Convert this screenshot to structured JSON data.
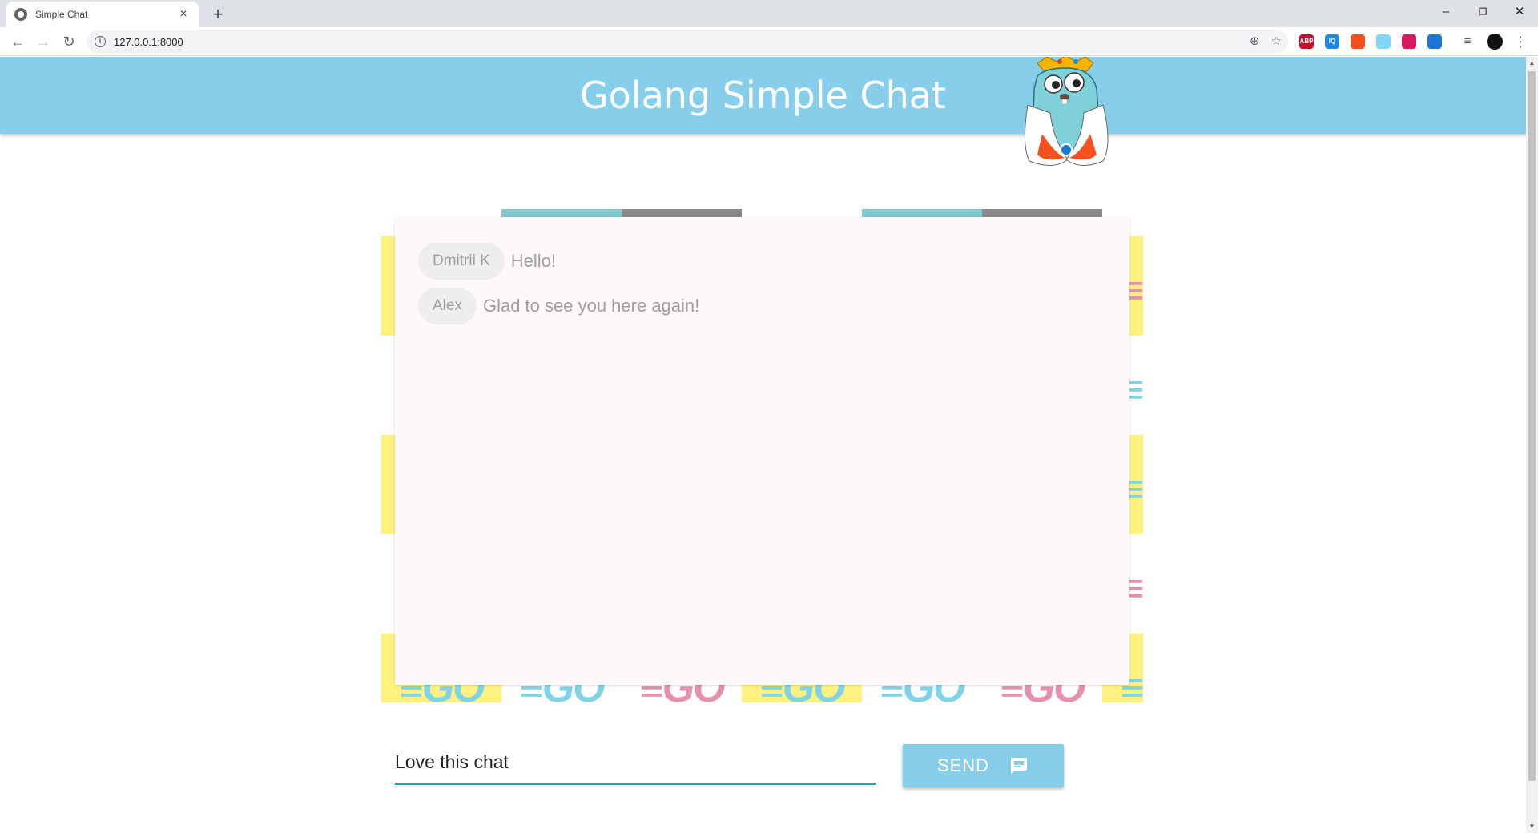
{
  "browser": {
    "tab_title": "Simple Chat",
    "tab_close": "×",
    "new_tab": "+",
    "url": "127.0.0.1:8000",
    "window_controls": {
      "minimize": "–",
      "restore": "❐",
      "close": "✕"
    },
    "extensions": [
      {
        "name": "adblock-plus-icon",
        "label": "ABP",
        "color": "#c70d2c"
      },
      {
        "name": "iq-icon",
        "label": "IQ",
        "color": "#1e88e5"
      },
      {
        "name": "fire-icon",
        "label": "",
        "color": "#f4511e"
      },
      {
        "name": "cloud-icon",
        "label": "",
        "color": "#81d4fa"
      },
      {
        "name": "instagram-icon",
        "label": "",
        "color": "#d81b60"
      },
      {
        "name": "square-icon",
        "label": "",
        "color": "#1976d2"
      }
    ]
  },
  "header": {
    "title": "Golang Simple Chat"
  },
  "messages": [
    {
      "author": "Dmitrii K",
      "text": "Hello!"
    },
    {
      "author": "Alex",
      "text": "Glad to see you here again!"
    }
  ],
  "composer": {
    "value": "Love this chat",
    "send_label": "SEND"
  },
  "colors": {
    "accent": "#87ceeb",
    "underline": "#26a69a",
    "tile_yellow": "#fff17f",
    "tile_teal": "#7fc9d0",
    "tile_gray": "#8a8a8a"
  }
}
